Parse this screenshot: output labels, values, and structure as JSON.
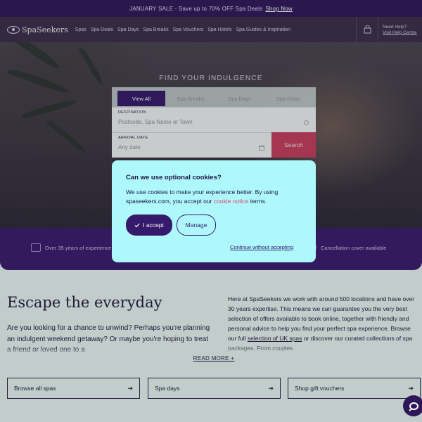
{
  "announcement": {
    "text": "JANUARY SALE - Save up to 70% OFF Spa Deals",
    "link": "Shop Now"
  },
  "header": {
    "logo": "SpaSeekers",
    "nav": [
      "Spas",
      "Spa Deals",
      "Spa Days",
      "Spa Breaks",
      "Spa Vouchers",
      "Spa Hotels",
      "Spa Guides & Inspiration"
    ],
    "help_label": "Need Help?",
    "help_link": "Visit Help Centre"
  },
  "hero": {
    "title": "FIND YOUR INDULGENCE",
    "tabs": [
      "View All",
      "Spa Breaks",
      "Spa Days",
      "Spa Deals"
    ],
    "active_tab": "View All",
    "destination_label": "DESTINATION",
    "destination_placeholder": "Postcode, Spa Name or Town",
    "arrival_label": "ARRIVAL DATE",
    "arrival_placeholder": "Any date",
    "search_button": "Search"
  },
  "trust": {
    "left": "Over 35 years of experience",
    "right": "Cancellation cover available"
  },
  "content": {
    "heading": "Escape the everyday",
    "intro": "Are you looking for a chance to unwind? Perhaps you're planning an indulgent weekend getaway? Or maybe you're hoping to treat a friend or loved one to a",
    "right_pre": "Here at SpaSeekers we work with around 500 locations and have over 30 years expertise. This means we can guarantee you the very best selection of offers available to book online, together with friendly and personal advice to help you find your perfect spa experience. Browse our full ",
    "right_link": "selection of UK spas",
    "right_post": " or discover our curated collections of spa packages. From couples",
    "read_more": "READ MORE +"
  },
  "cta": {
    "browse": "Browse all spas",
    "days": "Spa days",
    "vouchers": "Shop gift vouchers",
    "arrow": "➔"
  },
  "cookie": {
    "title": "Can we use optional cookies?",
    "text_pre": "We use cookies to make your experience better. By using spaseekers.com, you accept our ",
    "notice_link": "cookie notice",
    "text_post": " terms.",
    "accept": "I accept",
    "manage": "Manage",
    "continue": "Continue without accepting"
  },
  "colors": {
    "brand_purple": "#35196a",
    "accent_pink": "#c43c5e",
    "modal_bg": "#aef8fc"
  }
}
